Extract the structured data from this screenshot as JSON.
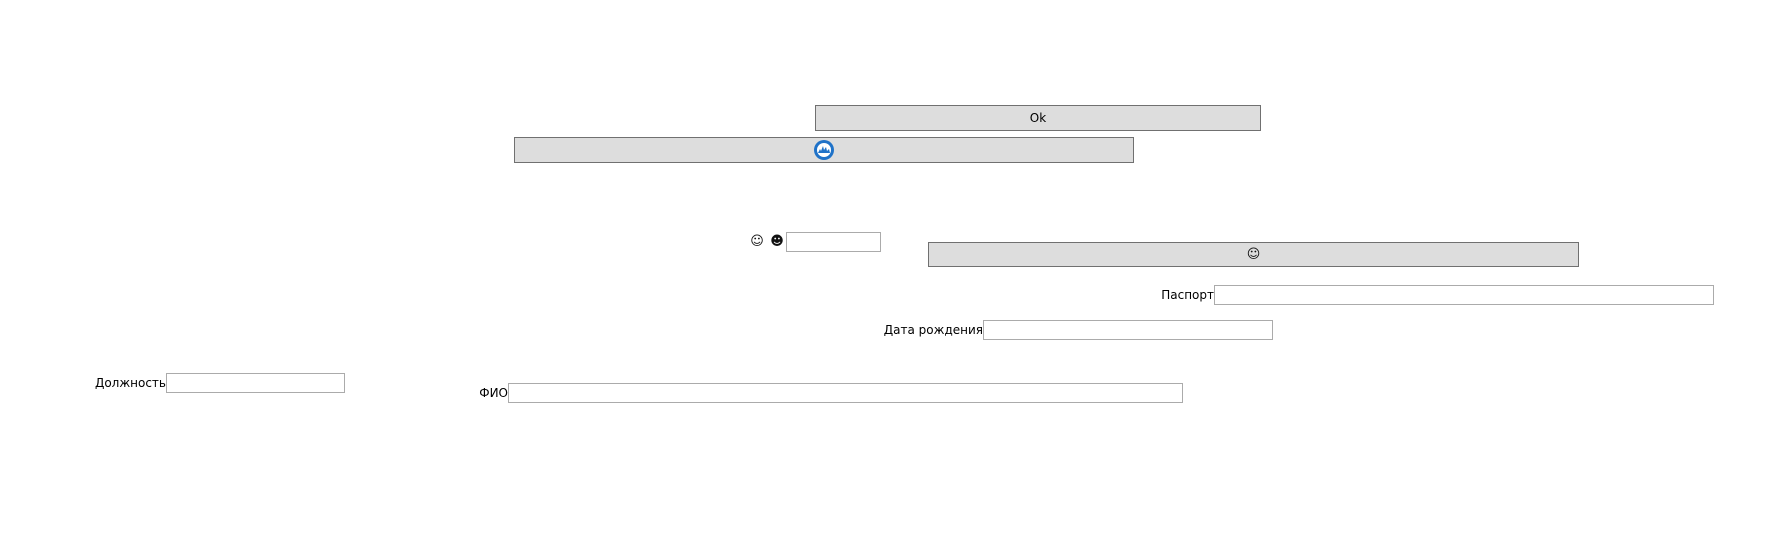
{
  "buttons": {
    "ok_label": "Ok",
    "logo_icon": "blue-globe-logo-icon",
    "emoji_button_icon": "smiling-face-icon"
  },
  "emoji_glyphs": {
    "face1": "☺",
    "face2": "☻",
    "face3": "☺"
  },
  "form": {
    "small_input": {
      "value": ""
    },
    "passport": {
      "label": "Паспорт",
      "value": ""
    },
    "birth_date": {
      "label": "Дата рождения",
      "value": ""
    },
    "position": {
      "label": "Должность",
      "value": ""
    },
    "full_name": {
      "label": "ФИО",
      "value": ""
    }
  },
  "colors": {
    "button_bg": "#dddddd",
    "button_border": "#707070",
    "field_border": "#ababab",
    "logo_blue": "#1f72c8"
  }
}
